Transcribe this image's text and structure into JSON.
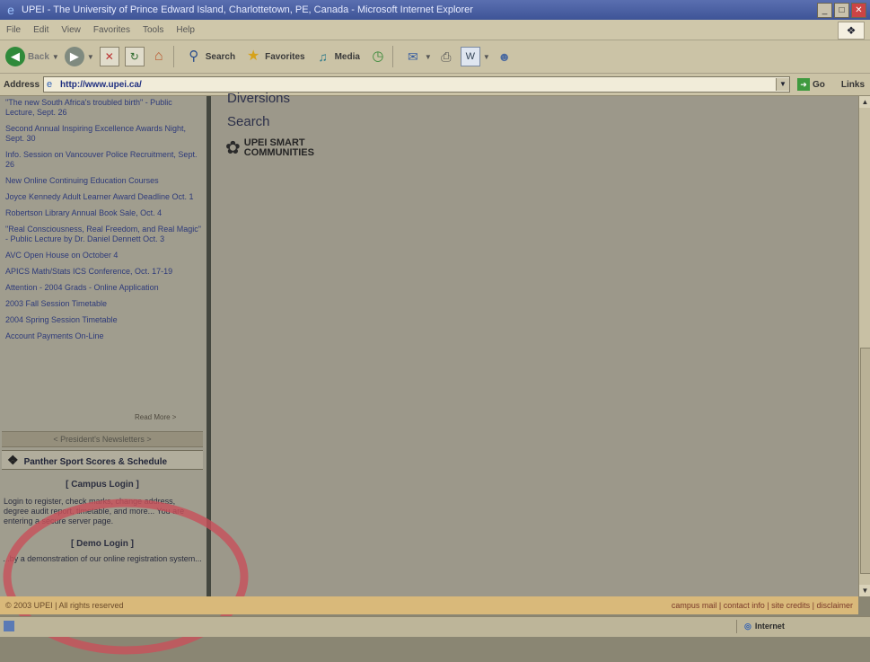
{
  "window": {
    "title": "UPEI - The University of Prince Edward Island, Charlottetown, PE, Canada - Microsoft Internet Explorer"
  },
  "menu": [
    "File",
    "Edit",
    "View",
    "Favorites",
    "Tools",
    "Help"
  ],
  "toolbar": {
    "back_label": "Back",
    "search_label": "Search",
    "favorites_label": "Favorites",
    "media_label": "Media"
  },
  "address": {
    "label": "Address",
    "url": "http://www.upei.ca/",
    "go_label": "Go",
    "links_label": "Links"
  },
  "news": [
    "\"The new South Africa's troubled birth\" - Public Lecture, Sept. 26",
    "Second Annual Inspiring Excellence Awards Night, Sept. 30",
    "Info. Session on Vancouver Police Recruitment, Sept. 26",
    "New Online Continuing Education Courses",
    "Joyce Kennedy Adult Learner Award Deadline Oct. 1",
    "Robertson Library Annual Book Sale, Oct. 4",
    "\"Real Consciousness, Real Freedom, and Real Magic\" - Public Lecture by Dr. Daniel Dennett Oct. 3",
    "AVC Open House on October 4",
    "APICS Math/Stats ICS Conference, Oct. 17-19",
    "Attention - 2004 Grads - Online Application",
    "2003 Fall Session Timetable",
    "2004 Spring Session Timetable",
    "Account Payments On-Line"
  ],
  "left": {
    "more_news": "Read More >",
    "presidents_newsletters": "< President's Newsletters >",
    "panther_sport": "Panther Sport Scores & Schedule",
    "campus_login": "[ Campus Login ]",
    "login_desc": "Login to register, check marks, change address, degree audit report, timetable, and more... You are entering a secure server page.",
    "demo_login": "[ Demo Login ]",
    "demo_desc": "...by a demonstration of our online registration system..."
  },
  "right": {
    "diversions": "Diversions",
    "search": "Search",
    "smart_line1": "UPEI SMART",
    "smart_line2": "COMMUNITIES"
  },
  "footer": {
    "copyright": "© 2003 UPEI | All rights reserved",
    "links": "campus mail | contact info | site credits | disclaimer"
  },
  "status": {
    "zone": "Internet"
  }
}
